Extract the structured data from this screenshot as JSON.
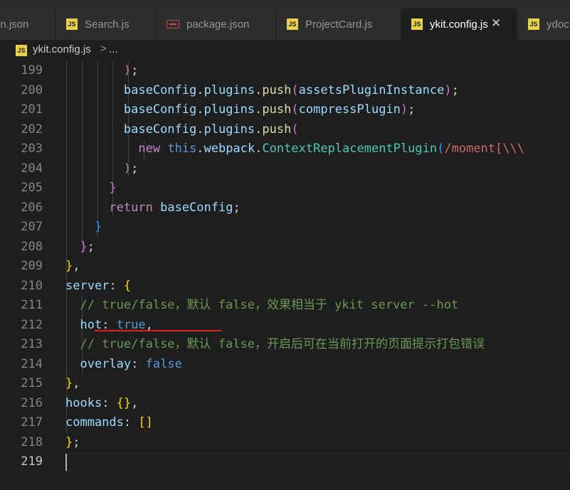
{
  "tabs": [
    {
      "label": "an.json",
      "icon": "json-icon",
      "active": false
    },
    {
      "label": "Search.js",
      "icon": "js-icon",
      "active": false
    },
    {
      "label": "package.json",
      "icon": "json-icon",
      "active": false
    },
    {
      "label": "ProjectCard.js",
      "icon": "js-icon",
      "active": false
    },
    {
      "label": "ykit.config.js",
      "icon": "js-icon",
      "active": true
    },
    {
      "label": "ydoc",
      "icon": "js-icon",
      "active": false
    }
  ],
  "js_icon_text": "JS",
  "close_glyph": "✕",
  "breadcrumb": {
    "file": "ykit.config.js",
    "separator": ">",
    "more": "..."
  },
  "editor": {
    "current_line": 219,
    "lines": [
      {
        "n": 199,
        "text": "        );"
      },
      {
        "n": 200,
        "text": "        baseConfig.plugins.push(assetsPluginInstance);"
      },
      {
        "n": 201,
        "text": "        baseConfig.plugins.push(compressPlugin);"
      },
      {
        "n": 202,
        "text": "        baseConfig.plugins.push("
      },
      {
        "n": 203,
        "text": "          new this.webpack.ContextReplacementPlugin(/moment[\\\\\\"
      },
      {
        "n": 204,
        "text": "        );"
      },
      {
        "n": 205,
        "text": "      }"
      },
      {
        "n": 206,
        "text": "      return baseConfig;"
      },
      {
        "n": 207,
        "text": "    }"
      },
      {
        "n": 208,
        "text": "  };"
      },
      {
        "n": 209,
        "text": "},"
      },
      {
        "n": 210,
        "text": "server: {"
      },
      {
        "n": 211,
        "text": "  // true/false，默认 false，效果相当于 ykit server --hot"
      },
      {
        "n": 212,
        "text": "  hot: true,"
      },
      {
        "n": 213,
        "text": "  // true/false，默认 false，开启后可在当前打开的页面提示打包错误"
      },
      {
        "n": 214,
        "text": "  overlay: false"
      },
      {
        "n": 215,
        "text": "},"
      },
      {
        "n": 216,
        "text": "hooks: {},"
      },
      {
        "n": 217,
        "text": "commands: []"
      },
      {
        "n": 218,
        "text": "};"
      },
      {
        "n": 219,
        "text": ""
      }
    ]
  },
  "colors": {
    "background": "#1e1e1e",
    "keyword": "#c586c0",
    "variable": "#9cdcfe",
    "function": "#dcdcaa",
    "comment": "#6a9955",
    "constant": "#569cd6",
    "annotation_underline": "#e0201f"
  }
}
